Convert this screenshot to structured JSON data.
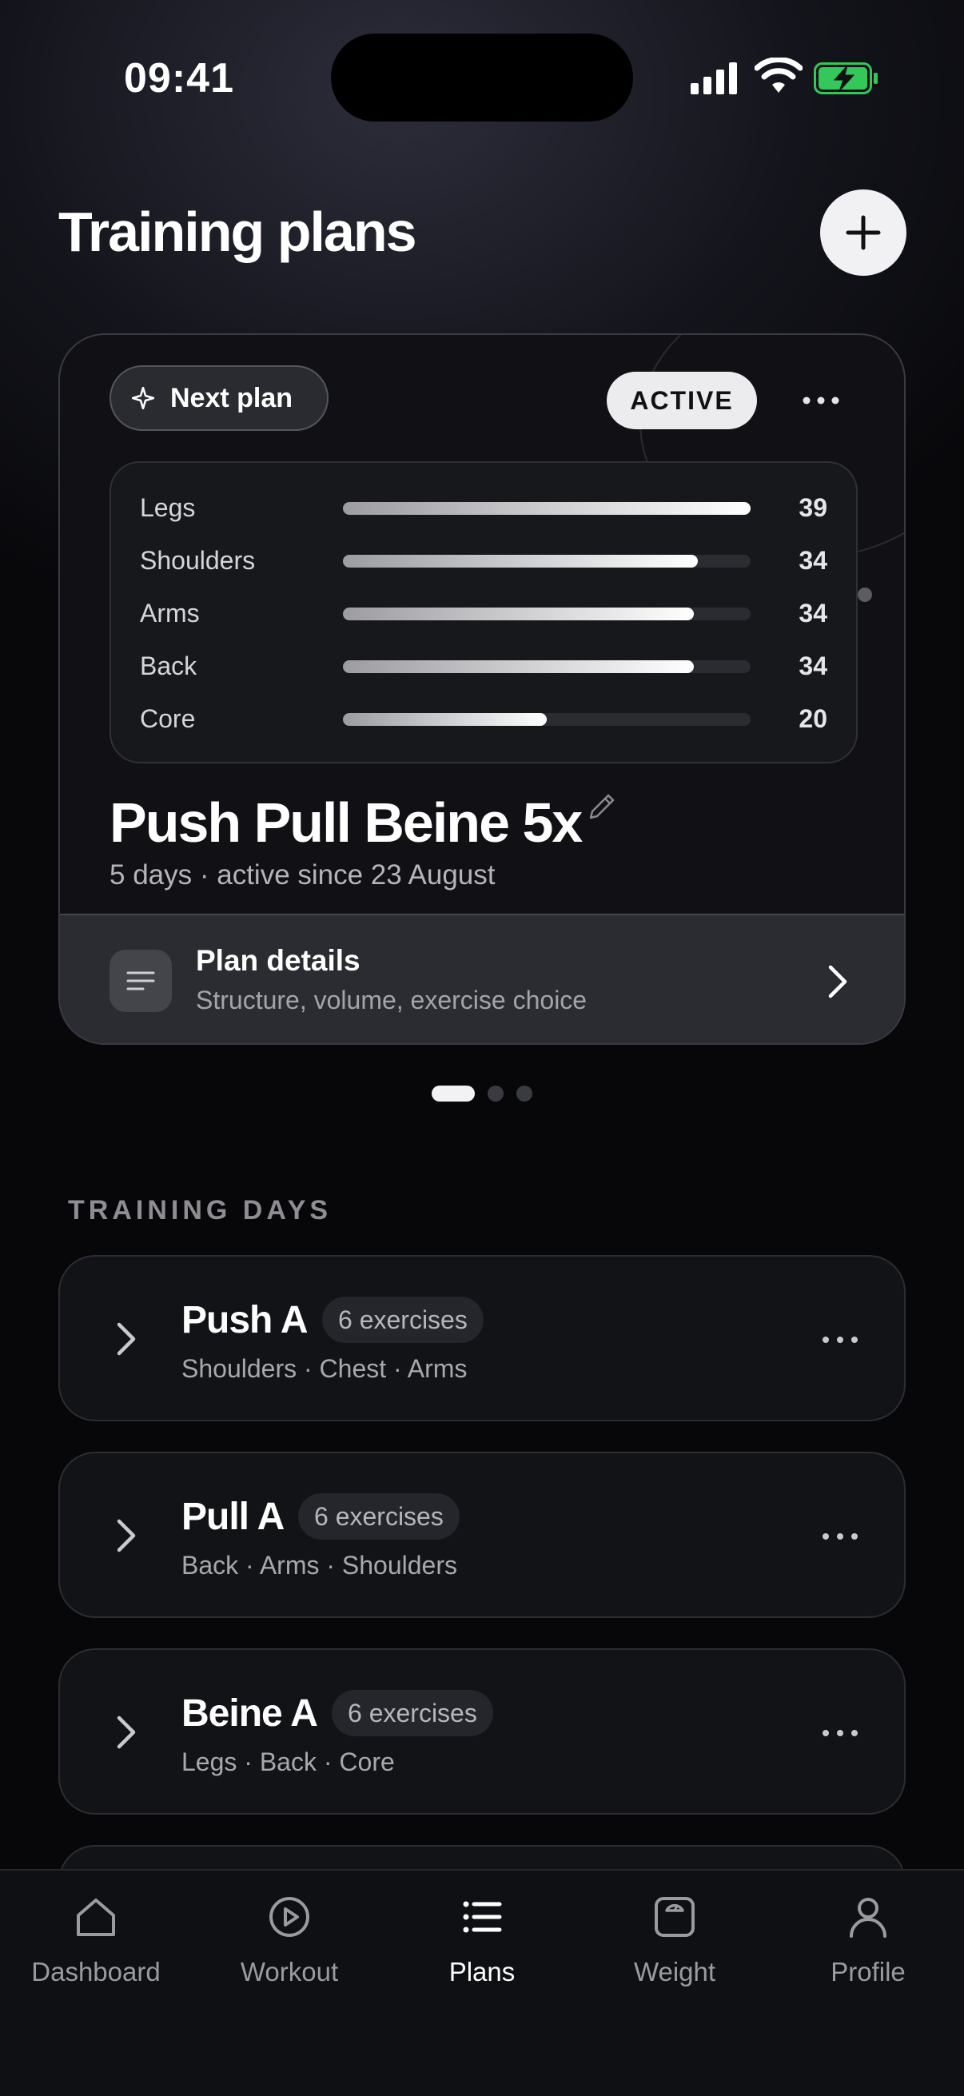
{
  "status_bar": {
    "time": "09:41"
  },
  "header": {
    "title": "Training plans"
  },
  "plan_card": {
    "next_plan_label": "Next plan",
    "status_badge": "ACTIVE",
    "muscle_stats": [
      {
        "label": "Legs",
        "value": "39",
        "fill": 1.0
      },
      {
        "label": "Shoulders",
        "value": "34",
        "fill": 0.87
      },
      {
        "label": "Arms",
        "value": "34",
        "fill": 0.86
      },
      {
        "label": "Back",
        "value": "34",
        "fill": 0.86
      },
      {
        "label": "Core",
        "value": "20",
        "fill": 0.5
      }
    ],
    "name": "Push Pull Beine 5x",
    "subtitle": "5 days · active since 23 August",
    "details": {
      "title": "Plan details",
      "subtitle": "Structure, volume, exercise choice"
    }
  },
  "pager": {
    "count": 3,
    "active_index": 0
  },
  "training_days": {
    "section_title": "TRAINING DAYS",
    "days": [
      {
        "name": "Push A",
        "count": "6 exercises",
        "tags": "Shoulders · Chest · Arms"
      },
      {
        "name": "Pull A",
        "count": "6 exercises",
        "tags": "Back · Arms · Shoulders"
      },
      {
        "name": "Beine A",
        "count": "6 exercises",
        "tags": "Legs · Back · Core"
      }
    ]
  },
  "tab_bar": {
    "active": "Plans",
    "tabs": [
      {
        "label": "Dashboard",
        "icon": "home-icon"
      },
      {
        "label": "Workout",
        "icon": "play-circle-icon"
      },
      {
        "label": "Plans",
        "icon": "list-icon"
      },
      {
        "label": "Weight",
        "icon": "scale-icon"
      },
      {
        "label": "Profile",
        "icon": "person-icon"
      }
    ]
  },
  "colors": {
    "background": "#08080b",
    "card": "#111115",
    "accent": "#ffffff",
    "battery_charging": "#34c759"
  }
}
